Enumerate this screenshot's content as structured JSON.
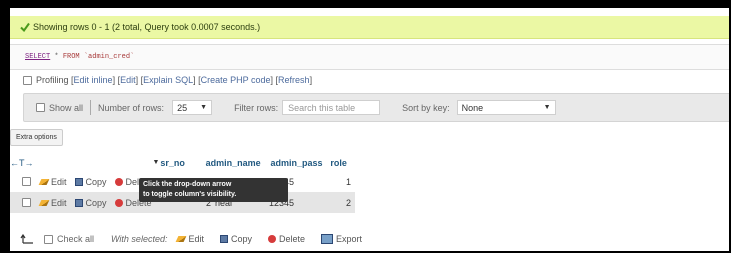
{
  "message": {
    "text": "Showing rows 0 - 1 (2 total, Query took 0.0007 seconds.)"
  },
  "sql": {
    "keyword": "SELECT",
    "star": "*",
    "from": "FROM",
    "table": "`admin_cred`"
  },
  "links": {
    "profiling": "Profiling",
    "edit_inline": "Edit inline",
    "edit": "Edit",
    "explain": "Explain SQL",
    "create_php": "Create PHP code",
    "refresh": "Refresh"
  },
  "nav": {
    "show_all": "Show all",
    "rows_label": "Number of rows:",
    "rows_value": "25",
    "filter_label": "Filter rows:",
    "filter_placeholder": "Search this table",
    "sort_label": "Sort by key:",
    "sort_value": "None"
  },
  "extra_options": "Extra options",
  "table": {
    "arrows": "←T→",
    "columns": [
      "sr_no",
      "admin_name",
      "admin_pass",
      "role"
    ],
    "actions": {
      "edit": "Edit",
      "copy": "Copy",
      "delete": "Delete"
    },
    "rows": [
      {
        "sr_no": "",
        "admin_name": "",
        "admin_pass": "12345",
        "role": "1"
      },
      {
        "sr_no": "2",
        "admin_name": "neal",
        "admin_pass": "12345",
        "role": "2"
      }
    ]
  },
  "tooltip": {
    "line1": "Click the drop-down arrow",
    "line2": "to toggle column's visibility."
  },
  "footer": {
    "check_all": "Check all",
    "with_selected": "With selected:",
    "edit": "Edit",
    "copy": "Copy",
    "delete": "Delete",
    "export": "Export"
  },
  "icons": {
    "success": "check-icon",
    "edit": "pencil-icon",
    "copy": "copy-icon",
    "delete": "delete-icon",
    "export": "export-icon"
  },
  "colors": {
    "success_bg": "#ebf8a4",
    "link": "#4d6b9d",
    "header": "#235a81"
  }
}
